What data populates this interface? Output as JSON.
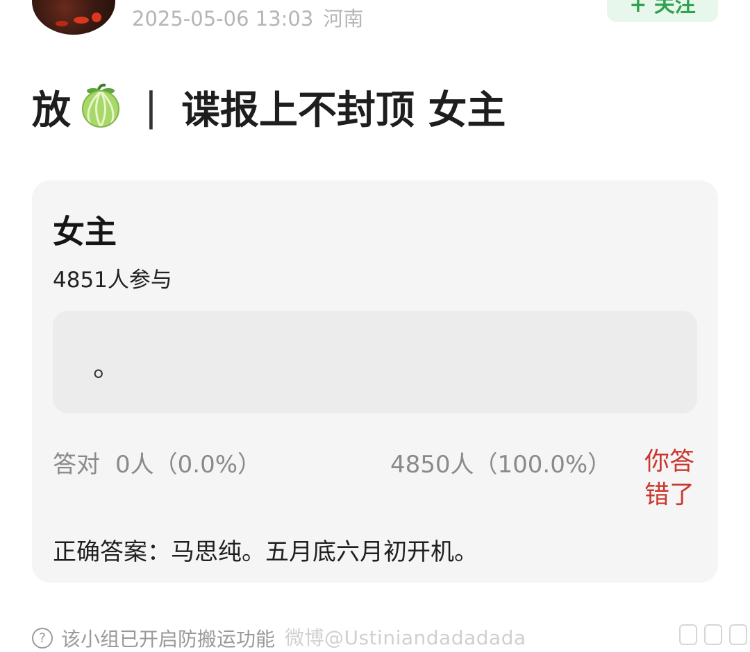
{
  "header": {
    "timestamp": "2025-05-06 13:03",
    "location": "河南",
    "follow_label": "+ 关注"
  },
  "post": {
    "title_prefix": "放",
    "separator": "|",
    "title_rest": "谍报上不封顶 女主",
    "emoji_icon": "melon-icon"
  },
  "quiz": {
    "question": "女主",
    "participants": "4851人参与",
    "option_text": "。",
    "correct_label": "答对",
    "correct_stat": "0人（0.0%）",
    "wrong_stat": "4850人（100.0%）",
    "result": "你答错了",
    "answer": "正确答案：马思纯。五月底六月初开机。"
  },
  "footer": {
    "notice": "该小组已开启防搬运功能",
    "watermark": "微博@Ustiniandadadada"
  },
  "colors": {
    "accent_green": "#2fa24f",
    "wrong_red": "#c9382f",
    "card_bg": "#f5f5f5"
  }
}
